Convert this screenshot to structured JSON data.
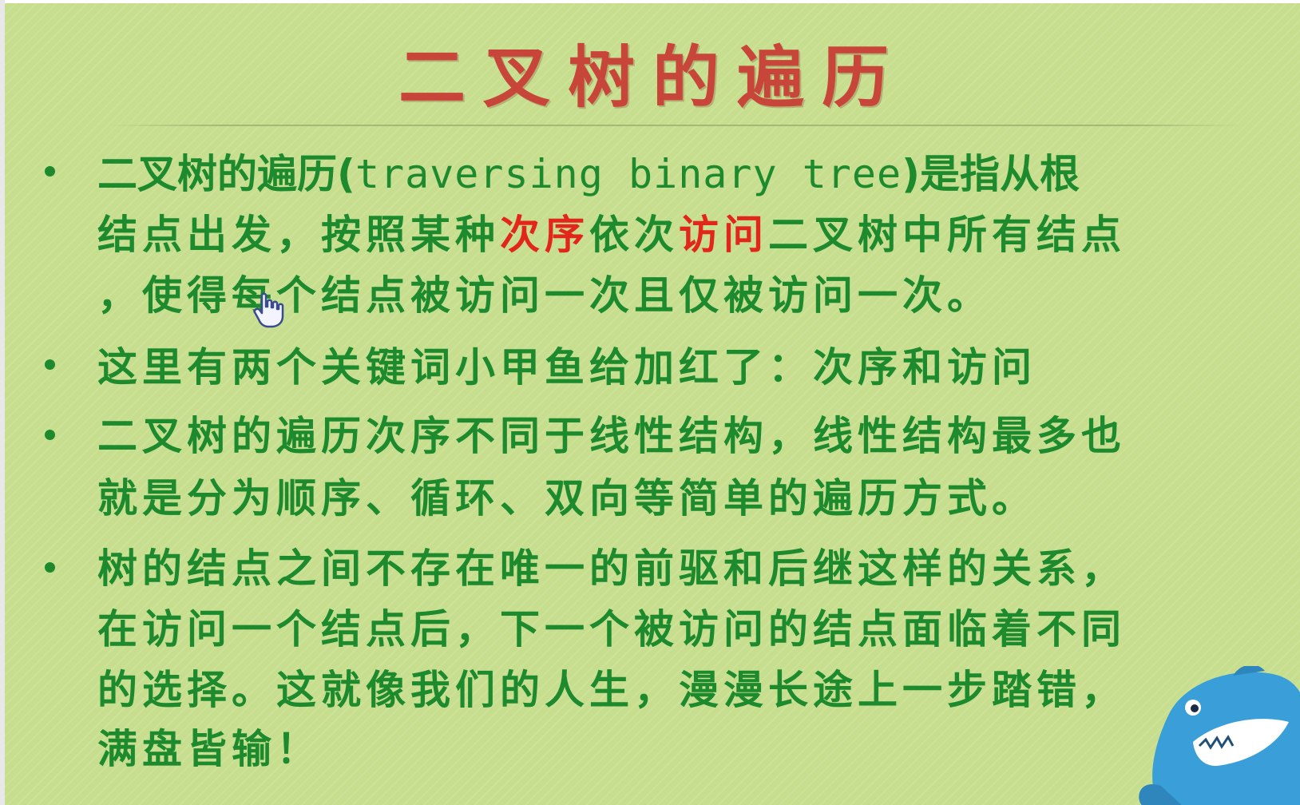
{
  "title": "二叉树的遍历",
  "bullets": [
    {
      "lines": [
        [
          "二叉树的遍历(",
          "traversing binary tree",
          ")是指从根"
        ],
        [
          "结点出发，按照某种",
          "次序",
          "依次",
          "访问",
          "二叉树中所有结点"
        ],
        [
          "，使得每个结点被访问一次且仅被访问一次。"
        ]
      ]
    },
    {
      "lines": [
        [
          "这里有两个关键词小甲鱼给加红了：次序和访问"
        ]
      ]
    },
    {
      "lines": [
        [
          "二叉树的遍历次序不同于线性结构，线性结构最多也"
        ],
        [
          "就是分为顺序、循环、双向等简单的遍历方式。"
        ]
      ]
    },
    {
      "lines": [
        [
          "树的结点之间不存在唯一的前驱和后继这样的关系，"
        ],
        [
          "在访问一个结点后，下一个被访问的结点面临着不同"
        ],
        [
          "的选择。这就像我们的人生，漫漫长途上一步踏错，"
        ],
        [
          "满盘皆输！"
        ]
      ]
    }
  ],
  "colors": {
    "background": "#c6de8e",
    "title": "#c8453a",
    "text": "#1d8a2e",
    "highlight": "#e3261b"
  },
  "icons": [
    "hand-cursor-icon",
    "shark-mascot-icon"
  ]
}
